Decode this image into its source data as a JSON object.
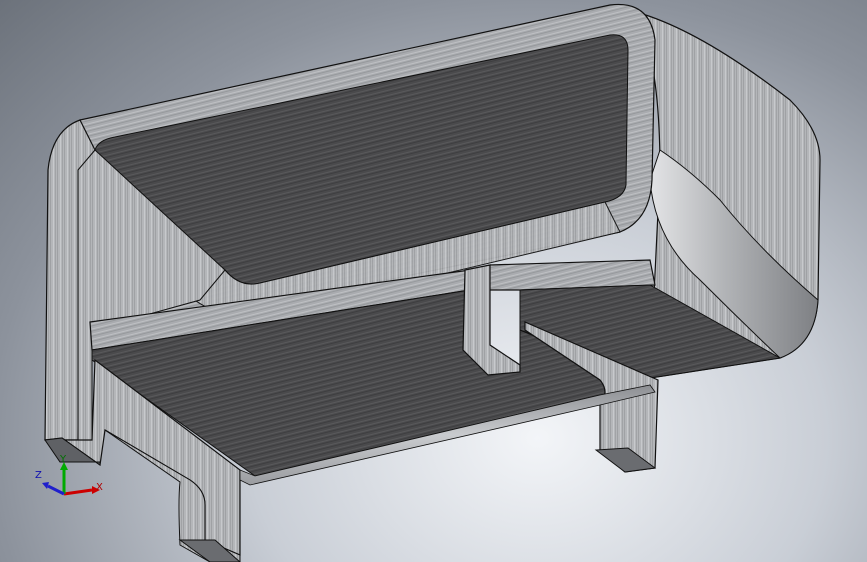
{
  "graphics_area": {
    "triad": {
      "x_label": "X",
      "y_label": "Y",
      "z_label": "Z",
      "x_color": "#cc0000",
      "y_color": "#00aa00",
      "z_color": "#1f1fcc"
    },
    "model": {
      "face_dark": "#4a4a4c",
      "face_light": "#b7b9bc",
      "face_mid": "#8c8e92"
    }
  }
}
